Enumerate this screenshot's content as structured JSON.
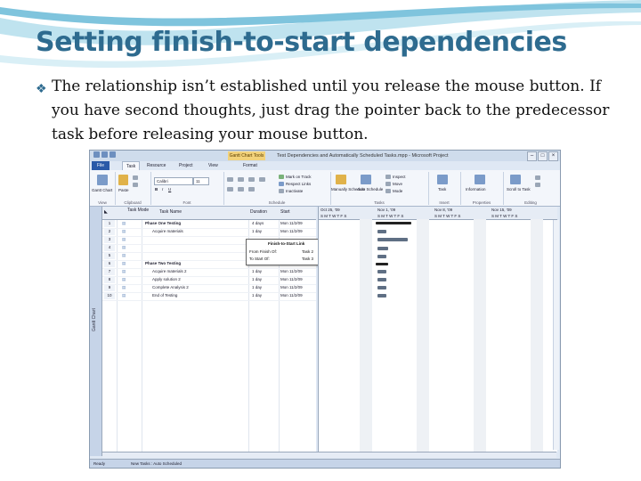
{
  "slide": {
    "title": "Setting finish-to-start dependencies",
    "bullet": "The relationship isn’t established until you release the mouse button. If you have second thoughts, just drag the pointer back to the predecessor task before releasing your mouse button."
  },
  "colors": {
    "title": "#2e6b8f",
    "swoosh": "#7fc4dd",
    "ribbon_tab_file": "#2a5aa8",
    "context_tab": "#f2d27a"
  },
  "window": {
    "context_tab": "Gantt Chart Tools",
    "title": "Test Dependencies and Automatically Scheduled Tasks.mpp - Microsoft Project",
    "tabs": [
      "File",
      "Task",
      "Resource",
      "Project",
      "View",
      "Format"
    ],
    "ribbon_groups": [
      "View",
      "Clipboard",
      "Font",
      "Schedule",
      "Tasks",
      "Insert",
      "Properties",
      "Editing"
    ],
    "ribbon_labels": {
      "gantt_chart": "Gantt Chart",
      "paste": "Paste",
      "font_name": "Calibri",
      "font_size": "11",
      "mark_on_track": "Mark on Track",
      "respect_links": "Respect Links",
      "inactivate": "Inactivate",
      "manually_schedule": "Manually Schedule",
      "auto_schedule": "Auto Schedule",
      "inspect": "Inspect",
      "move": "Move",
      "mode": "Mode",
      "task": "Task",
      "information": "Information",
      "scroll_to_task": "Scroll to Task"
    }
  },
  "grid": {
    "headers": [
      "Task Mode",
      "Task Name",
      "Duration",
      "Start"
    ],
    "sidebar_label": "Gantt Chart",
    "rows": [
      {
        "num": "1",
        "name": "Phase One Testing",
        "duration": "4 days",
        "start": "Mon 11/2/09"
      },
      {
        "num": "2",
        "name": "Acquire materials",
        "duration": "1 day",
        "start": "Mon 11/2/09"
      },
      {
        "num": "3",
        "name": "",
        "duration": "",
        "start": ""
      },
      {
        "num": "4",
        "name": "",
        "duration": "",
        "start": ""
      },
      {
        "num": "5",
        "name": "",
        "duration": "",
        "start": ""
      },
      {
        "num": "6",
        "name": "Phase Two Testing",
        "duration": "1 day",
        "start": "Mon 11/2/09"
      },
      {
        "num": "7",
        "name": "Acquire materials 2",
        "duration": "1 day",
        "start": "Mon 11/2/09"
      },
      {
        "num": "8",
        "name": "Apply solution 2",
        "duration": "1 day",
        "start": "Mon 11/2/09"
      },
      {
        "num": "9",
        "name": "Complete Analysis 2",
        "duration": "1 day",
        "start": "Mon 11/2/09"
      },
      {
        "num": "10",
        "name": "End of Testing",
        "duration": "1 day",
        "start": "Mon 11/2/09"
      }
    ]
  },
  "tooltip": {
    "title": "Finish-to-Start Link",
    "from_label": "From Finish Of:",
    "from_value": "Task 2",
    "to_label": "To Start Of:",
    "to_value": "Task 3"
  },
  "gantt": {
    "weeks": [
      "Oct 25, '09",
      "Nov 1, '09",
      "Nov 8, '09",
      "Nov 15, '09"
    ],
    "days": "S M T W T F S"
  },
  "status": {
    "ready": "Ready",
    "new_tasks": "New Tasks : Auto Scheduled"
  }
}
